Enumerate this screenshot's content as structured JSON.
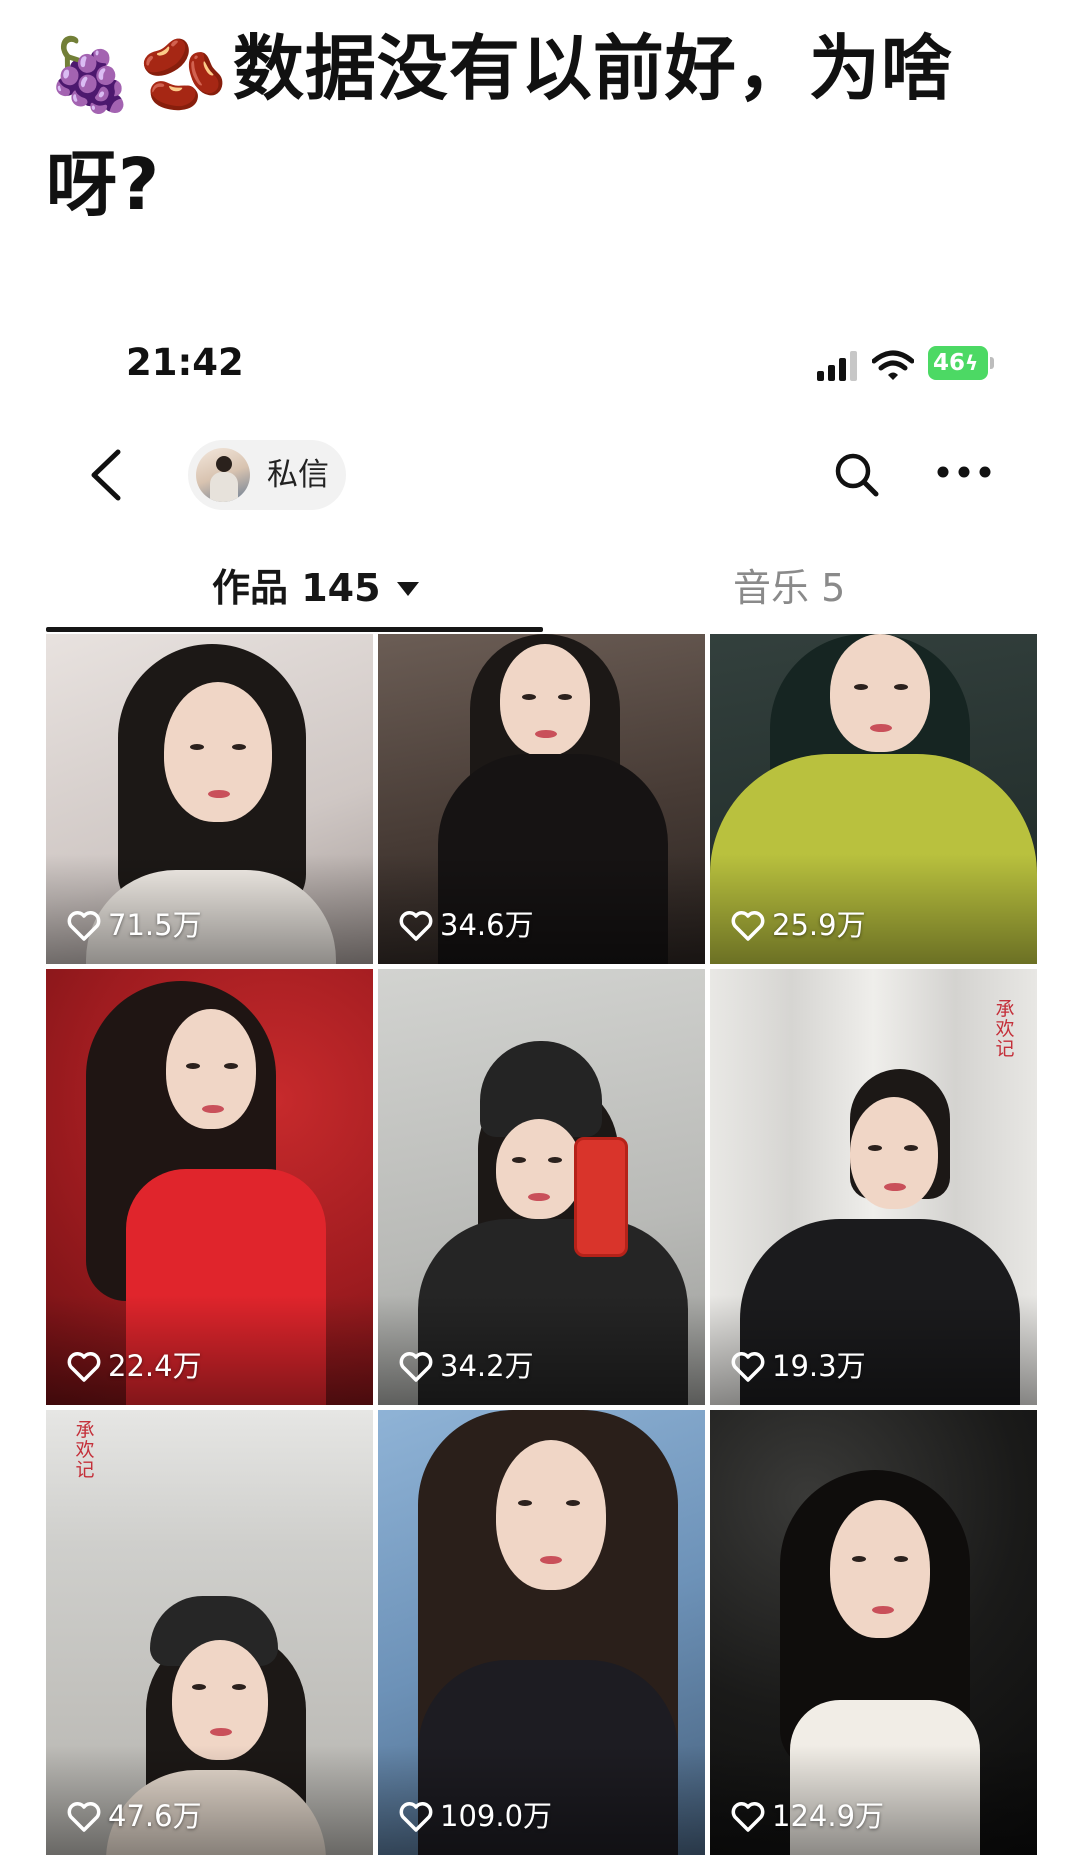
{
  "post": {
    "emoji_grapes": "🍇",
    "emoji_beans": "🫘",
    "title": "数据没有以前好，为啥呀?"
  },
  "status_bar": {
    "time": "21:42",
    "battery": "46"
  },
  "header": {
    "dm_label": "私信"
  },
  "tabs": {
    "works_label": "作品 145",
    "music_label": "音乐 5"
  },
  "grid": {
    "tiles": [
      {
        "likes": "71.5万"
      },
      {
        "likes": "34.6万"
      },
      {
        "likes": "25.9万"
      },
      {
        "likes": "22.4万"
      },
      {
        "likes": "34.2万"
      },
      {
        "likes": "19.3万"
      },
      {
        "likes": "47.6万"
      },
      {
        "likes": "109.0万"
      },
      {
        "likes": "124.9万"
      }
    ],
    "stamp_text": "承欢记"
  },
  "colors": {
    "battery": "#4cd964",
    "active_tab": "#161616",
    "inactive_tab": "#8a8a8a"
  },
  "icons": [
    "back-arrow-icon",
    "avatar",
    "search-icon",
    "more-dots-icon",
    "caret-down-icon",
    "heart-icon",
    "signal-icon",
    "wifi-icon",
    "battery-icon"
  ]
}
